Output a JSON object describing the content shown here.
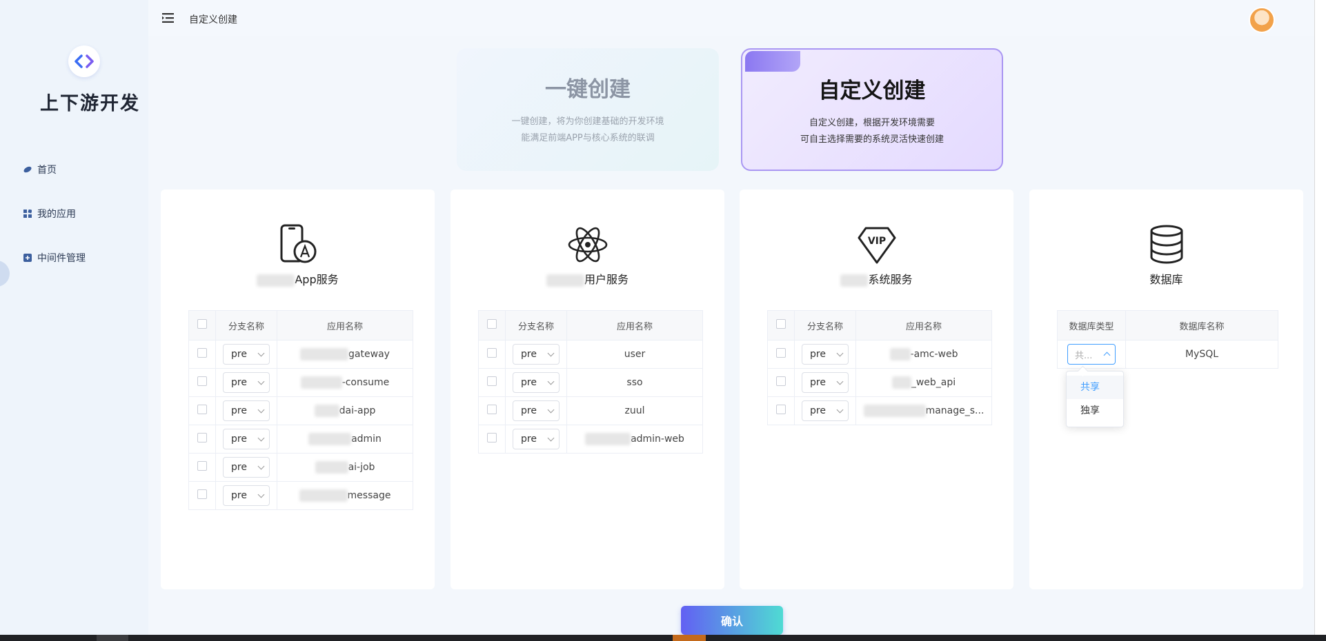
{
  "header": {
    "title": "自定义创建"
  },
  "sidebar": {
    "logo_text": "上下游开发",
    "items": [
      {
        "label": "首页",
        "icon": "planet-icon"
      },
      {
        "label": "我的应用",
        "icon": "apps-icon"
      },
      {
        "label": "中间件管理",
        "icon": "middleware-icon"
      }
    ]
  },
  "modes": {
    "quick": {
      "title": "一键创建",
      "desc_line1": "一键创建，将为你创建基础的开发环境",
      "desc_line2": "能满足前端APP与核心系统的联调"
    },
    "custom": {
      "title": "自定义创建",
      "desc_line1": "自定义创建，根据开发环境需要",
      "desc_line2": "可自主选择需要的系统灵活快速创建"
    }
  },
  "columns": {
    "branch": "分支名称",
    "app": "应用名称",
    "db_type": "数据库类型",
    "db_name": "数据库名称"
  },
  "panels": {
    "app": {
      "title": "App服务",
      "rows": [
        {
          "branch": "pre",
          "app": "gateway"
        },
        {
          "branch": "pre",
          "app": "-consume"
        },
        {
          "branch": "pre",
          "app": "dai-app"
        },
        {
          "branch": "pre",
          "app": "admin"
        },
        {
          "branch": "pre",
          "app": "ai-job"
        },
        {
          "branch": "pre",
          "app": "message"
        }
      ]
    },
    "user": {
      "title": "用户服务",
      "rows": [
        {
          "branch": "pre",
          "app": "user"
        },
        {
          "branch": "pre",
          "app": "sso"
        },
        {
          "branch": "pre",
          "app": "zuul"
        },
        {
          "branch": "pre",
          "app": "admin-web"
        }
      ]
    },
    "system": {
      "title": "系统服务",
      "vip_text": "VIP",
      "rows": [
        {
          "branch": "pre",
          "app": "-amc-web"
        },
        {
          "branch": "pre",
          "app": "_web_api"
        },
        {
          "branch": "pre",
          "app": "manage_s..."
        }
      ]
    },
    "database": {
      "title": "数据库",
      "rows": [
        {
          "db_type": "共...",
          "db_name": "MySQL"
        }
      ]
    }
  },
  "dropdown": {
    "options": [
      "共享",
      "独享"
    ],
    "selected": "共享"
  },
  "confirm_label": "确认",
  "colors": {
    "primary": "#409eff",
    "accent_purple": "#a996f2",
    "button_start": "#6260f3",
    "button_end": "#4fdbd3"
  }
}
